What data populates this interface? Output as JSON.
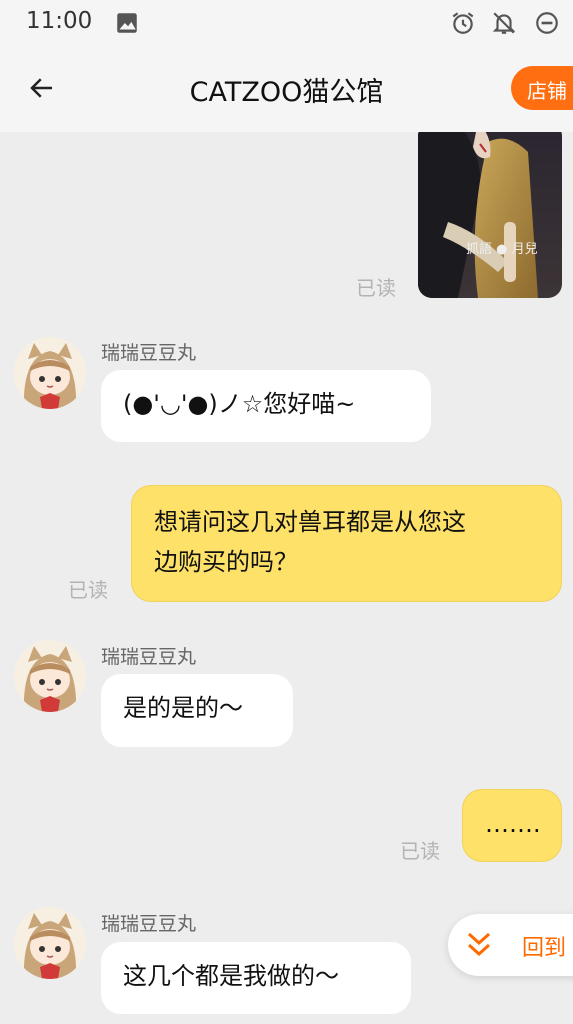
{
  "status_bar": {
    "time": "11:00",
    "icons": [
      "image-icon",
      "alarm-icon",
      "notifications-off-icon",
      "do-not-disturb-icon"
    ]
  },
  "header": {
    "title": "CATZOO猫公馆",
    "shop_label": "店铺"
  },
  "messages": [
    {
      "type": "image",
      "side": "out",
      "read": "已读",
      "image_caption": "抓語 ● 月兒"
    },
    {
      "type": "text",
      "side": "in",
      "sender": "瑞瑞豆豆丸",
      "text": "(●'◡'●)ノ☆您好喵~"
    },
    {
      "type": "text",
      "side": "out",
      "read": "已读",
      "lines": [
        "想请问这几对兽耳都是从您这",
        "边购买的吗？"
      ]
    },
    {
      "type": "text",
      "side": "in",
      "sender": "瑞瑞豆豆丸",
      "text": "是的是的～"
    },
    {
      "type": "text",
      "side": "out",
      "read": "已读",
      "text": "……."
    },
    {
      "type": "text",
      "side": "in",
      "sender": "瑞瑞豆豆丸",
      "text": "这几个都是我做的～"
    }
  ],
  "jump_button": {
    "label": "回到"
  },
  "colors": {
    "accent": "#ff6e11",
    "out_bubble": "#fee169",
    "in_bubble": "#ffffff",
    "background": "#ededed"
  }
}
